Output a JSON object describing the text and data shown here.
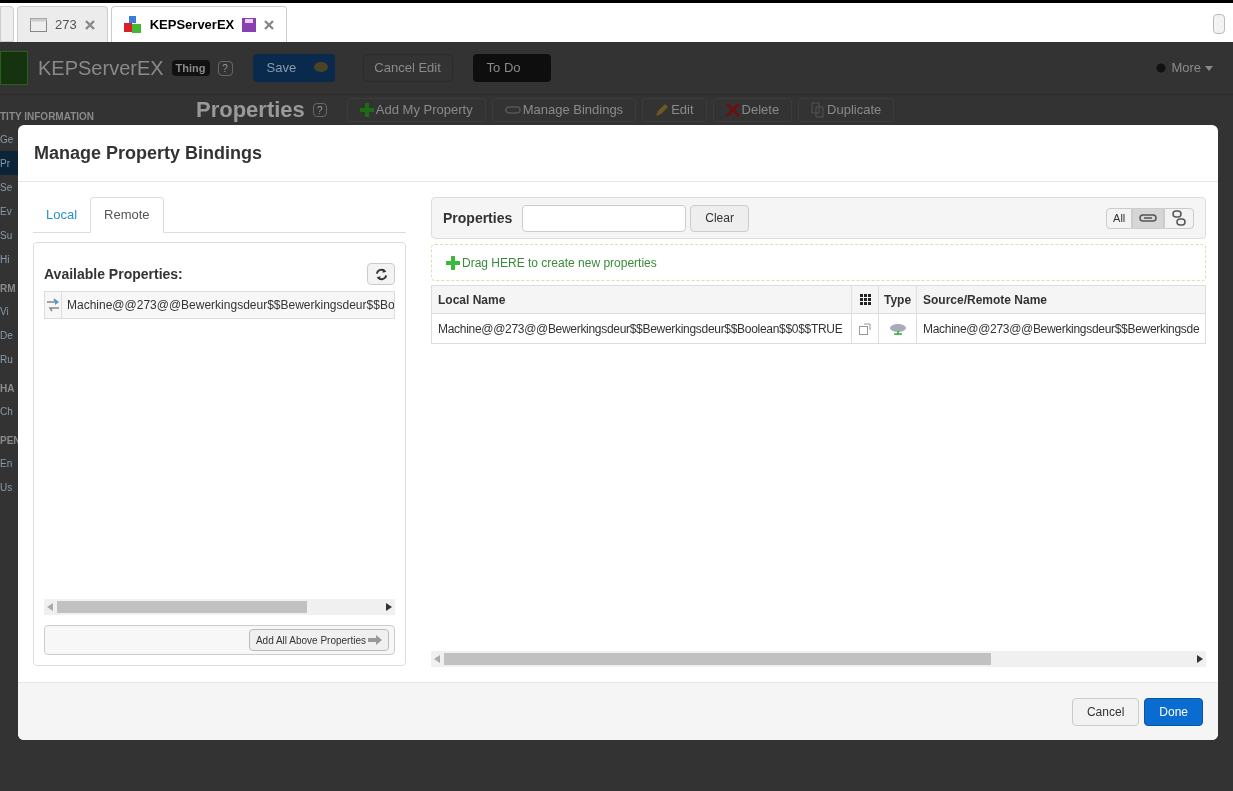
{
  "browser_tabs": [
    {
      "label": "273",
      "selected": false,
      "kind": "window"
    },
    {
      "label": "KEPServerEX",
      "selected": true,
      "kind": "thing"
    }
  ],
  "header": {
    "title": "KEPServerEX",
    "badge": "Thing",
    "help": "?",
    "save": "Save",
    "cancel": "Cancel Edit",
    "todo": "To Do",
    "more": "More"
  },
  "sidebar": {
    "sections": [
      {
        "title": "TITY INFORMATION",
        "items": [
          {
            "label": "Ge",
            "selected": false
          },
          {
            "label": "Pr",
            "selected": true
          },
          {
            "label": "Se",
            "selected": false
          },
          {
            "label": "Ev",
            "selected": false
          },
          {
            "label": "Su",
            "selected": false
          },
          {
            "label": "Hi",
            "selected": false
          }
        ]
      },
      {
        "title": "RM",
        "items": [
          {
            "label": "Vi",
            "selected": false
          },
          {
            "label": "De",
            "selected": false
          },
          {
            "label": "Ru",
            "selected": false
          }
        ]
      },
      {
        "title": "HA",
        "items": [
          {
            "label": "Ch",
            "selected": false
          }
        ]
      },
      {
        "title": "PEN",
        "items": [
          {
            "label": "En",
            "selected": false
          },
          {
            "label": "Us",
            "selected": false
          }
        ]
      }
    ]
  },
  "page": {
    "title": "Properties",
    "help": "?",
    "actions": [
      {
        "label": "Add My Property",
        "kind": "add"
      },
      {
        "label": "Manage Bindings",
        "kind": "link"
      },
      {
        "label": "Edit",
        "kind": "edit"
      },
      {
        "label": "Delete",
        "kind": "delete"
      },
      {
        "label": "Duplicate",
        "kind": "duplicate"
      }
    ]
  },
  "dialog": {
    "title": "Manage Property Bindings",
    "tabs": [
      {
        "label": "Local",
        "selected": false
      },
      {
        "label": "Remote",
        "selected": true
      }
    ],
    "available": {
      "title": "Available Properties:",
      "items": [
        "Machine@@273@@Bewerkingsdeur$$Bewerkingsdeur$$Bo"
      ],
      "add_all": "Add All Above Properties"
    },
    "properties": {
      "label": "Properties",
      "clear": "Clear",
      "filters": [
        {
          "kind": "all",
          "label": "All",
          "selected": false
        },
        {
          "kind": "bound",
          "selected": true
        },
        {
          "kind": "unbound",
          "selected": false
        }
      ],
      "drop_hint": "Drag HERE to create new properties",
      "columns": [
        "Local Name",
        "Type",
        "Source/Remote Name"
      ],
      "rows": [
        {
          "local_name": "Machine@@273@@Bewerkingsdeur$$Bewerkingsdeur$$Boolean$$0$$TRUE",
          "remote_name": "Machine@@273@@Bewerkingsdeur$$Bewerkingsde"
        }
      ]
    },
    "buttons": [
      {
        "label": "Cancel",
        "kind": "secondary"
      },
      {
        "label": "Done",
        "kind": "primary"
      }
    ]
  }
}
